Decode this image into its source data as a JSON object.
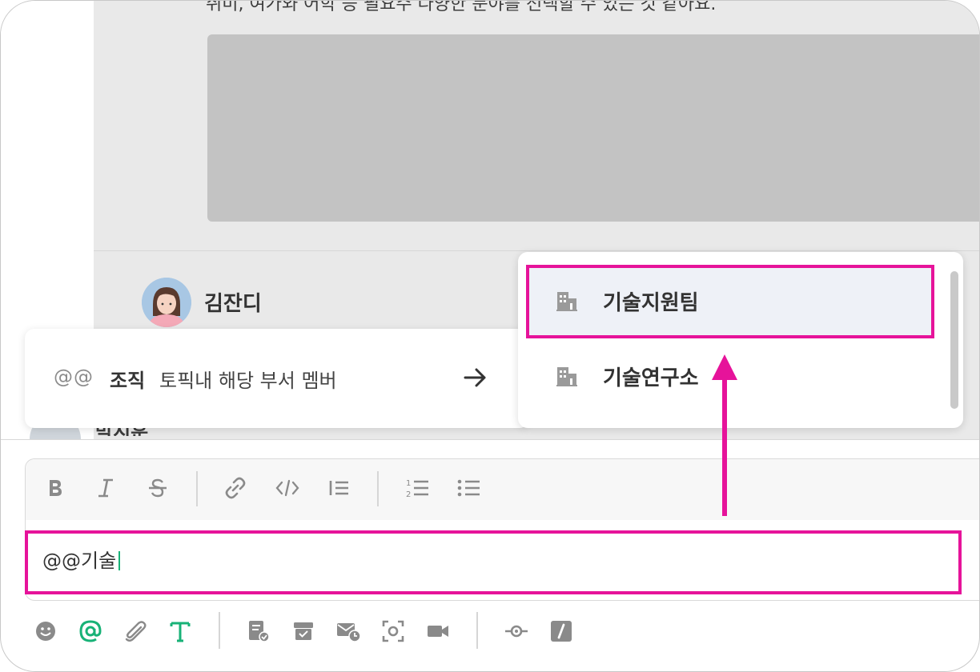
{
  "chat": {
    "message_text": "취미, 여가와 어학 등 필요주 다양한 분야를 선택할 수 있는 것 같아요.",
    "sender_name": "김잔디",
    "next_sender_name": "박지훈"
  },
  "mention_menu": {
    "prefix": "@@",
    "label": "조직",
    "description": "토픽내 해당 부서 멤버",
    "submenu": [
      {
        "label": "기술지원팀",
        "selected": true
      },
      {
        "label": "기술연구소",
        "selected": false
      }
    ]
  },
  "editor": {
    "input_value": "@@기술",
    "format_toolbar": [
      "bold-icon",
      "italic-icon",
      "strikethrough-icon",
      "link-icon",
      "code-icon",
      "blockquote-icon",
      "ordered-list-icon",
      "bullet-list-icon"
    ],
    "bottom_toolbar": [
      "emoji-icon",
      "mention-icon",
      "attach-icon",
      "text-format-icon",
      "todo-icon",
      "archive-icon",
      "scheduled-mail-icon",
      "screenshot-icon",
      "video-call-icon",
      "commit-icon",
      "slash-command-icon"
    ]
  },
  "colors": {
    "annotation": "#e6139a",
    "accent": "#18b277",
    "selected_row": "#eef1f7"
  }
}
